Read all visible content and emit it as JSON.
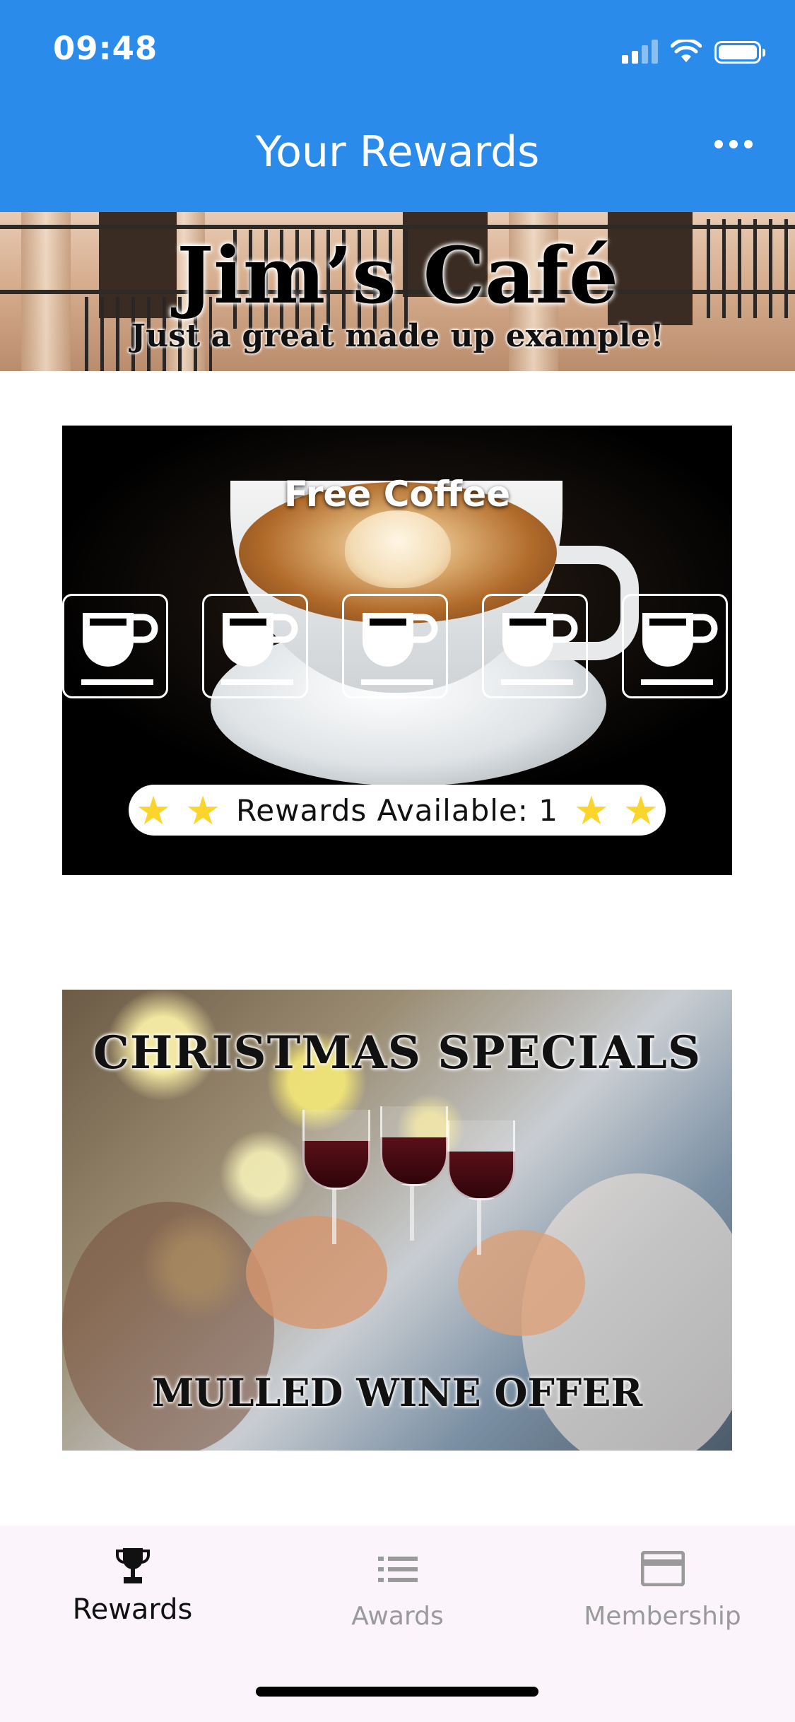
{
  "status_bar": {
    "time": "09:48"
  },
  "nav": {
    "title": "Your Rewards",
    "more_icon": "more-horizontal-icon"
  },
  "banner": {
    "title": "Jim’s Café",
    "subtitle": "Just a great made up example!"
  },
  "reward_card": {
    "title": "Free Coffee",
    "stamp_icon": "coffee-cup-icon",
    "stamps_total": 5,
    "rewards_available_text": "Rewards Available: 1",
    "star_color": "#fbd52b"
  },
  "promo_card": {
    "title": "CHRISTMAS SPECIALS",
    "subtitle": "MULLED WINE OFFER"
  },
  "tab_bar": {
    "tabs": [
      {
        "label": "Rewards",
        "icon": "trophy-icon",
        "active": true
      },
      {
        "label": "Awards",
        "icon": "list-icon",
        "active": false
      },
      {
        "label": "Membership",
        "icon": "card-icon",
        "active": false
      }
    ]
  },
  "colors": {
    "accent": "#2b8bea",
    "tab_inactive": "#9a9a9a",
    "tab_bar_bg": "#fbf5fb"
  }
}
